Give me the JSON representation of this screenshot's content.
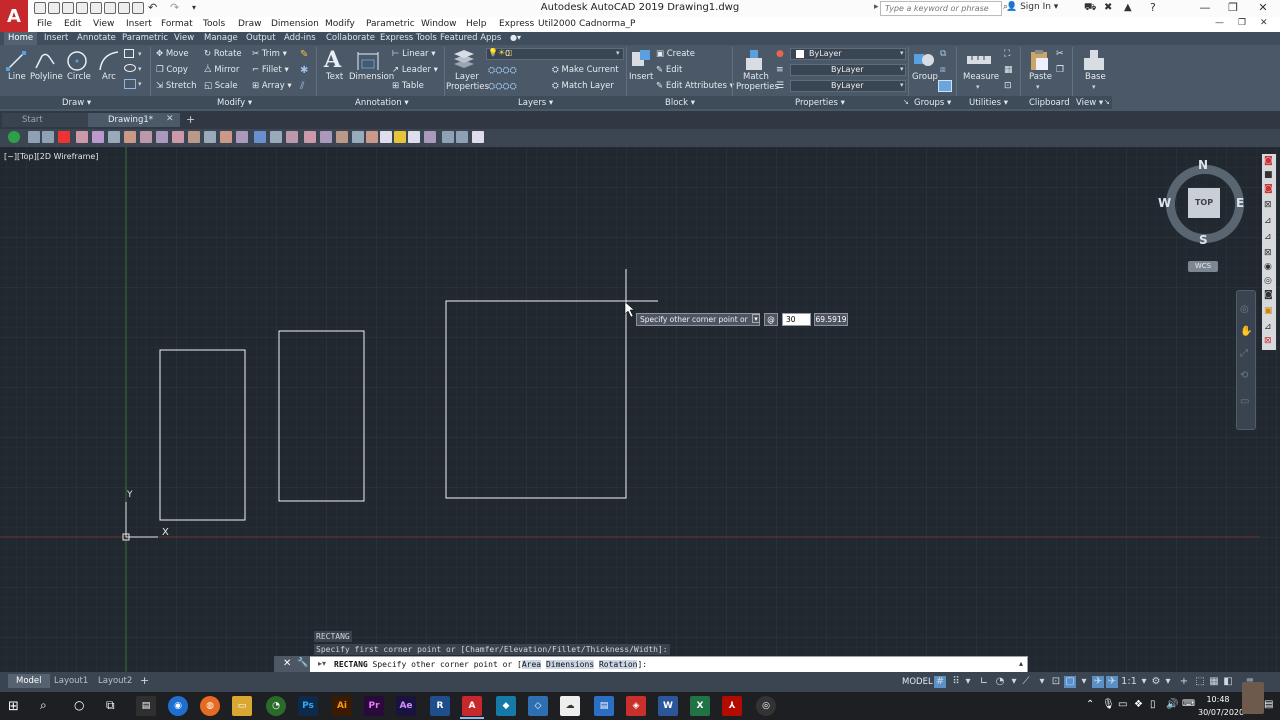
{
  "window": {
    "title": "Autodesk AutoCAD 2019    Drawing1.dwg",
    "search_placeholder": "Type a keyword or phrase",
    "sign_in": "Sign In",
    "app_letter": "A"
  },
  "menu": [
    "File",
    "Edit",
    "View",
    "Insert",
    "Format",
    "Tools",
    "Draw",
    "Dimension",
    "Modify",
    "Parametric",
    "Window",
    "Help",
    "Express",
    "Util2000",
    "Cadnorma_P"
  ],
  "ribbon_tabs": [
    "Home",
    "Insert",
    "Annotate",
    "Parametric",
    "View",
    "Manage",
    "Output",
    "Add-ins",
    "Collaborate",
    "Express Tools",
    "Featured Apps"
  ],
  "ribbon": {
    "draw": {
      "line": "Line",
      "polyline": "Polyline",
      "circle": "Circle",
      "arc": "Arc",
      "title": "Draw"
    },
    "modify": {
      "move": "Move",
      "rotate": "Rotate",
      "trim": "Trim",
      "copy": "Copy",
      "mirror": "Mirror",
      "fillet": "Fillet",
      "stretch": "Stretch",
      "scale": "Scale",
      "array": "Array",
      "title": "Modify"
    },
    "annotation": {
      "text": "Text",
      "dimension": "Dimension",
      "linear": "Linear",
      "leader": "Leader",
      "table": "Table",
      "title": "Annotation"
    },
    "layers": {
      "layer_properties_1": "Layer",
      "layer_properties_2": "Properties",
      "current_layer": "0",
      "make_current": "Make Current",
      "match_layer": "Match Layer",
      "title": "Layers"
    },
    "block": {
      "insert": "Insert",
      "create": "Create",
      "edit": "Edit",
      "edit_attributes": "Edit Attributes",
      "title": "Block"
    },
    "properties": {
      "match_1": "Match",
      "match_2": "Properties",
      "color": "ByLayer",
      "linetype": "ByLayer",
      "lineweight": "ByLayer",
      "title": "Properties"
    },
    "groups": {
      "group": "Group",
      "title": "Groups"
    },
    "utilities": {
      "measure": "Measure",
      "title": "Utilities"
    },
    "clipboard": {
      "paste": "Paste",
      "title": "Clipboard"
    },
    "view": {
      "base": "Base",
      "title": "View"
    }
  },
  "doc_tabs": {
    "start": "Start",
    "drawing": "Drawing1*"
  },
  "viewport_label": "[−][Top][2D Wireframe]",
  "viewcube": {
    "n": "N",
    "s": "S",
    "e": "E",
    "w": "W",
    "top": "TOP",
    "wcs": "WCS"
  },
  "ucs": {
    "x": "X",
    "y": "Y"
  },
  "dynamic_input": {
    "prompt": "Specify other corner point or",
    "at": "@",
    "value": "30",
    "angle": "69.5919"
  },
  "command": {
    "history_1": "RECTANG",
    "history_2": "Specify first corner point or [Chamfer/Elevation/Fillet/Thickness/Width]:",
    "cmd_name": "RECTANG",
    "prompt_pre": "Specify other corner point or [",
    "opt_area": "Area",
    "opt_dim": "Dimensions",
    "opt_rot": "Rotation",
    "prompt_post": "]:"
  },
  "layout_tabs": [
    "Model",
    "Layout1",
    "Layout2"
  ],
  "status": {
    "model": "MODEL",
    "scale": "1:1"
  },
  "clock": {
    "time": "10:48",
    "date": "30/07/2020"
  },
  "colors": {
    "accent": "#c6282c",
    "canvas": "#212830",
    "ribbon": "#4a5868"
  }
}
